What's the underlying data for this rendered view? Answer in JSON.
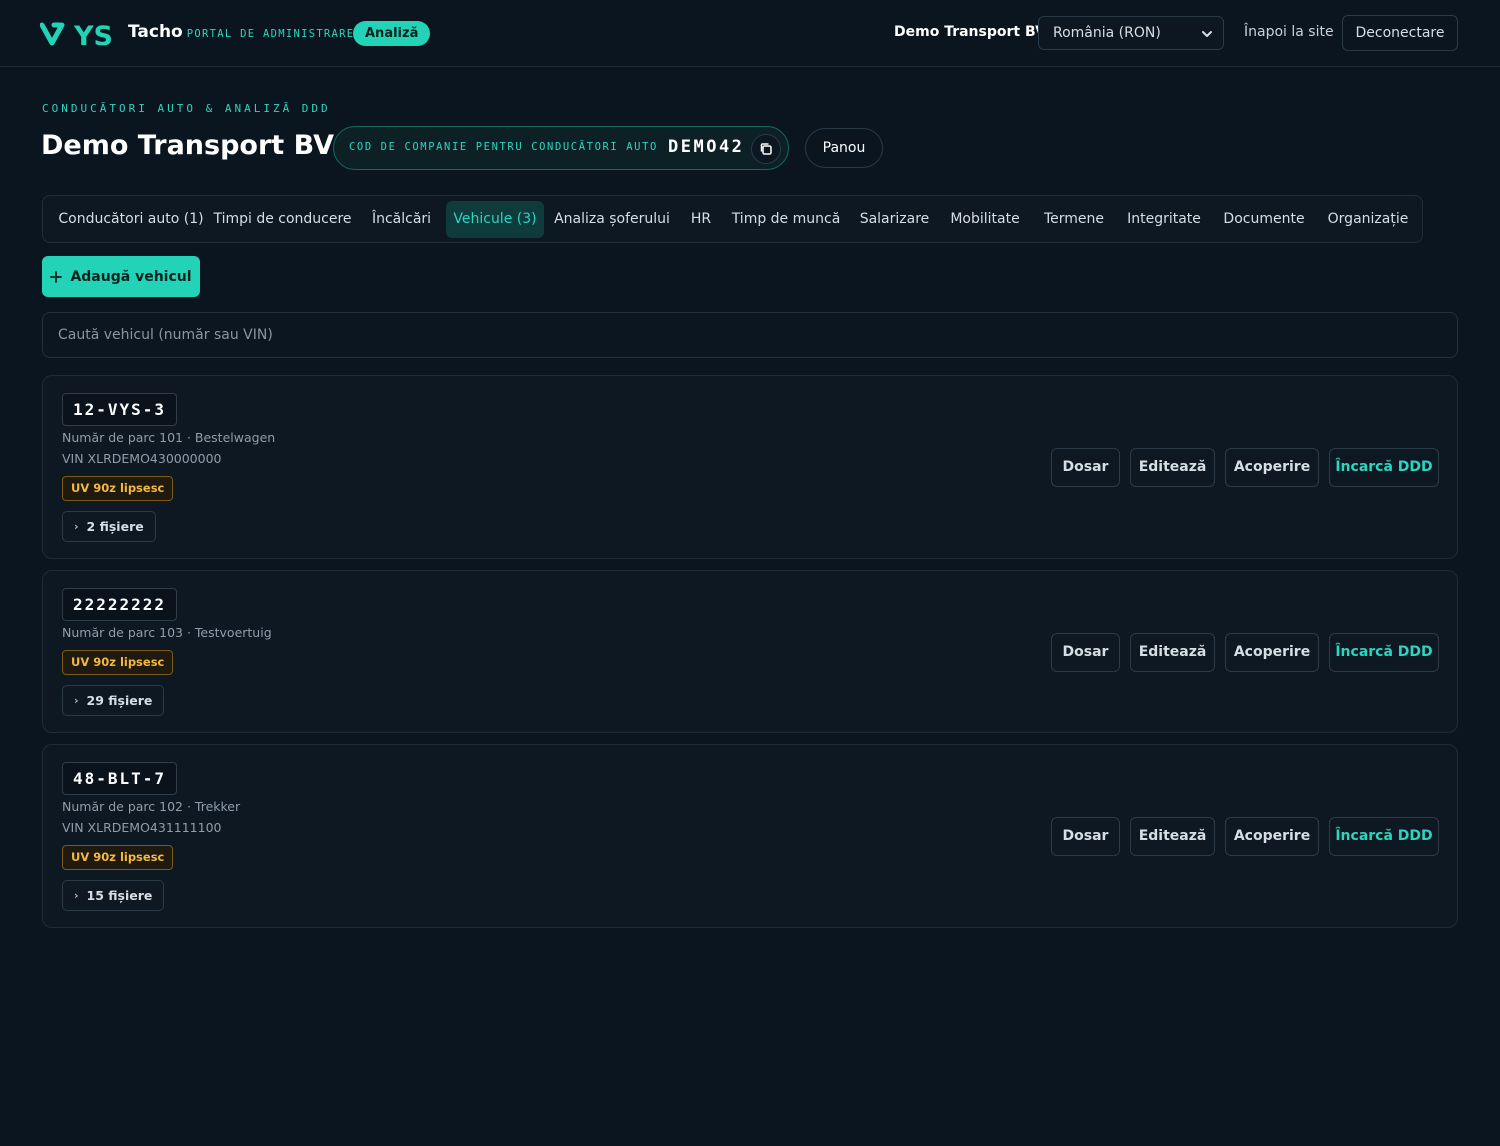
{
  "header": {
    "brand_name": "Tacho",
    "brand_sub": "PORTAL DE ADMINISTRARE",
    "analiza_pill": "Analiză",
    "company_name": "Demo Transport BV",
    "country_select": "România (RON)",
    "back_link": "Înapoi la site",
    "logout": "Deconectare"
  },
  "page": {
    "eyebrow": "CONDUCĂTORI AUTO & ANALIZĂ DDD",
    "title": "Demo Transport BV",
    "code_label": "COD DE COMPANIE PENTRU CONDUCĂTORI AUTO",
    "code_value": "DEMO42",
    "panou": "Panou"
  },
  "tabs": [
    {
      "label": "Conducători auto (1)",
      "active": false
    },
    {
      "label": "Timpi de conducere",
      "active": false
    },
    {
      "label": "Încălcări",
      "active": false
    },
    {
      "label": "Vehicule (3)",
      "active": true
    },
    {
      "label": "Analiza șoferului",
      "active": false
    },
    {
      "label": "HR",
      "active": false
    },
    {
      "label": "Timp de muncă",
      "active": false
    },
    {
      "label": "Salarizare",
      "active": false
    },
    {
      "label": "Mobilitate",
      "active": false
    },
    {
      "label": "Termene",
      "active": false
    },
    {
      "label": "Integritate",
      "active": false
    },
    {
      "label": "Documente",
      "active": false
    },
    {
      "label": "Organizație",
      "active": false
    }
  ],
  "add_vehicle": "Adaugă vehicul",
  "search": {
    "placeholder": "Caută vehicul (număr sau VIN)"
  },
  "actions": {
    "dosar": "Dosar",
    "edit": "Editează",
    "acoperire": "Acoperire",
    "ddd": "Încarcă DDD"
  },
  "vehicles": [
    {
      "plate": "12-VYS-3",
      "fleet": "Număr de parc 101 · Bestelwagen",
      "vin": "VIN XLRDEMO430000000",
      "badge": "UV 90z lipsesc",
      "files": "2 fișiere"
    },
    {
      "plate": "22222222",
      "fleet": "Număr de parc 103 · Testvoertuig",
      "vin": "",
      "badge": "UV 90z lipsesc",
      "files": "29 fișiere"
    },
    {
      "plate": "48-BLT-7",
      "fleet": "Număr de parc 102 · Trekker",
      "vin": "VIN XLRDEMO431111100",
      "badge": "UV 90z lipsesc",
      "files": "15 fișiere"
    }
  ],
  "colors": {
    "accent": "#22d3b8",
    "warn": "#f4b740",
    "background": "#0b1520"
  }
}
